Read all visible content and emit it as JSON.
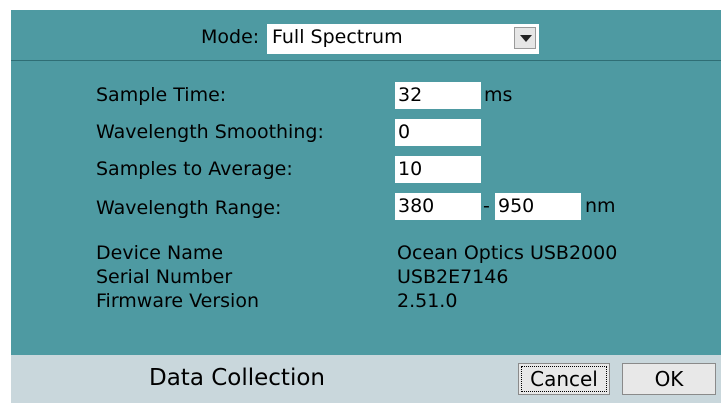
{
  "mode": {
    "label": "Mode:",
    "value": "Full Spectrum"
  },
  "fields": {
    "sample_time": {
      "label": "Sample Time:",
      "value": "32",
      "unit": "ms"
    },
    "smoothing": {
      "label": "Wavelength Smoothing:",
      "value": "0"
    },
    "samples_avg": {
      "label": "Samples to Average:",
      "value": "10"
    },
    "range": {
      "label": "Wavelength Range:",
      "min": "380",
      "separator": "-",
      "max": "950",
      "unit": "nm"
    }
  },
  "device": {
    "name_label": "Device Name",
    "name_value": "Ocean Optics USB2000",
    "serial_label": "Serial Number",
    "serial_value": "USB2E7146",
    "firmware_label": "Firmware Version",
    "firmware_value": "2.51.0"
  },
  "footer": {
    "title": "Data Collection",
    "cancel_label": "Cancel",
    "ok_label": "OK"
  },
  "icons": {
    "dropdown": "chevron-down-icon"
  },
  "colors": {
    "panel": "#4e9aa2",
    "footer": "#c9d7dc"
  }
}
